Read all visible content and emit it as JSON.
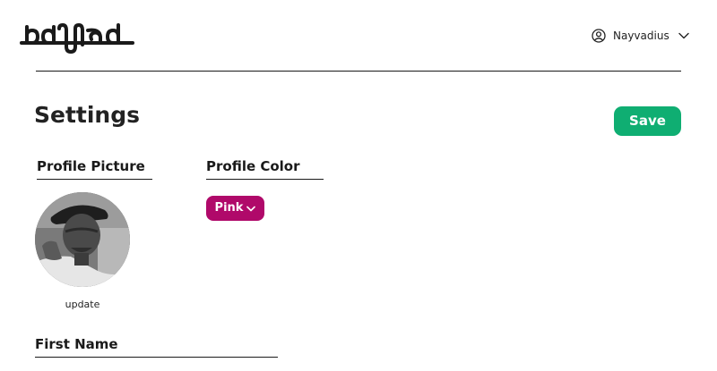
{
  "app": {
    "logo_icon": "badlad-wordmark-logo"
  },
  "header": {
    "user": {
      "icon": "user-circle-icon",
      "name": "Nayvadius",
      "menu_icon": "chevron-down-icon"
    }
  },
  "page": {
    "title": "Settings",
    "save_label": "Save",
    "save_color": "#0fae72"
  },
  "profile_picture": {
    "heading": "Profile Picture",
    "avatar_icon": "avatar-photo",
    "update_label": "update"
  },
  "profile_color": {
    "heading": "Profile Color",
    "selected": "Pink",
    "selected_color": "#b0096a",
    "menu_icon": "chevron-down-icon"
  },
  "first_name": {
    "heading": "First Name"
  }
}
